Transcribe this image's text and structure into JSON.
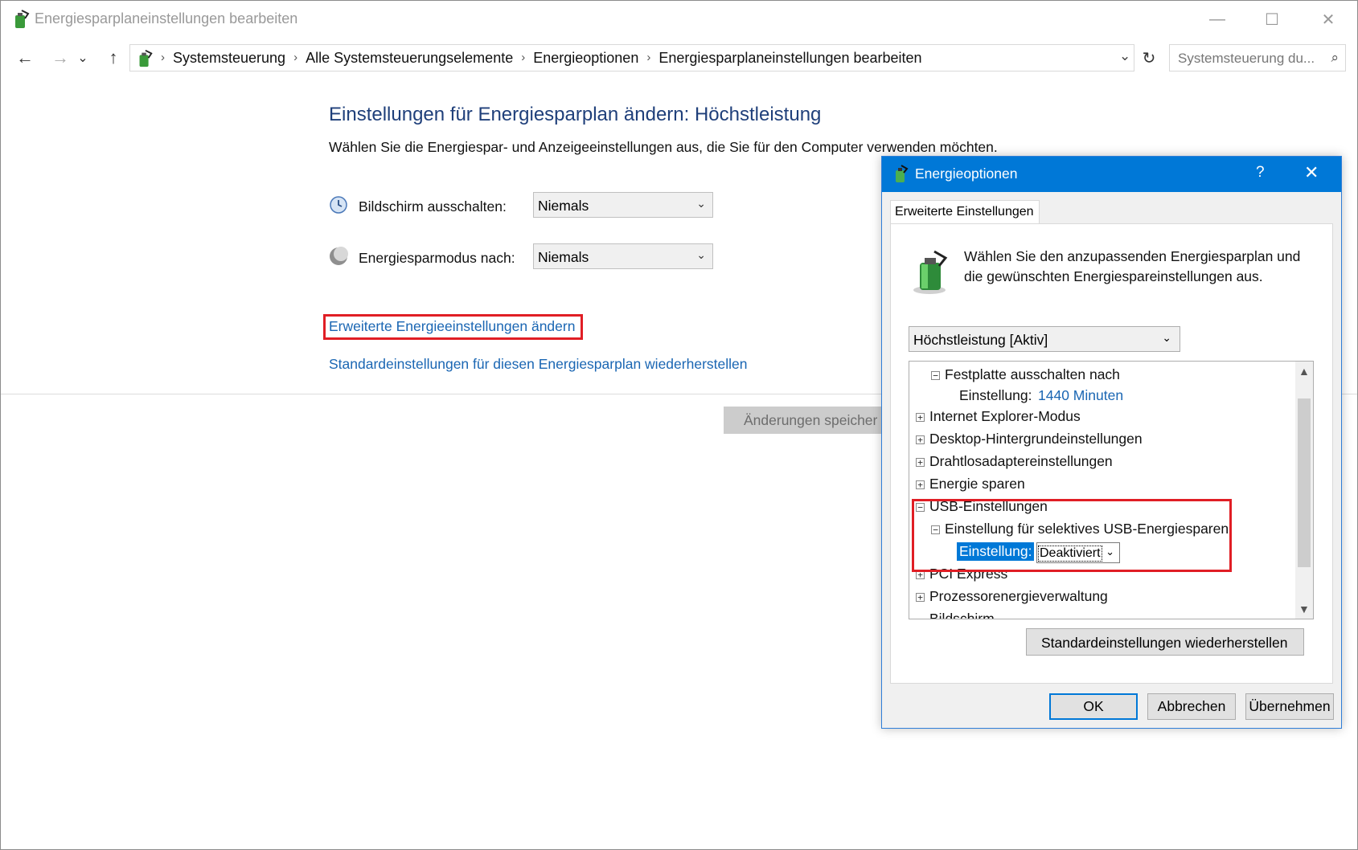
{
  "window": {
    "title": "Energiesparplaneinstellungen bearbeiten",
    "min": "—",
    "max": "☐",
    "close": "✕"
  },
  "nav": {
    "back": "←",
    "forward": "→",
    "recent": "⌄",
    "up": "↑",
    "breadcrumbs": [
      "Systemsteuerung",
      "Alle Systemsteuerungselemente",
      "Energieoptionen",
      "Energiesparplaneinstellungen bearbeiten"
    ],
    "sep": "›",
    "dropdown": "⌄",
    "refresh": "↻",
    "search_placeholder": "Systemsteuerung du...",
    "search_icon": "⌕"
  },
  "main": {
    "title": "Einstellungen für Energiesparplan ändern: Höchstleistung",
    "description": "Wählen Sie die Energiespar- und Anzeigeeinstellungen aus, die Sie für den Computer verwenden möchten.",
    "display_off": {
      "label": "Bildschirm ausschalten:",
      "value": "Niemals"
    },
    "sleep": {
      "label": "Energiesparmodus nach:",
      "value": "Niemals"
    },
    "advanced_link": "Erweiterte Energieeinstellungen ändern",
    "restore_link": "Standardeinstellungen für diesen Energiesparplan wiederherstellen",
    "save_button": "Änderungen speicher"
  },
  "dialog": {
    "title": "Energieoptionen",
    "help": "?",
    "close": "✕",
    "tab": "Erweiterte Einstellungen",
    "description": "Wählen Sie den anzupassenden Energiesparplan und die gewünschten Energiespareinstellungen aus.",
    "plan": "Höchstleistung [Aktiv]",
    "tree": {
      "hdd": "Festplatte ausschalten nach",
      "hdd_setting_label": "Einstellung:",
      "hdd_setting_value": "1440 Minuten",
      "ie": "Internet Explorer-Modus",
      "desktop": "Desktop-Hintergrundeinstellungen",
      "wireless": "Drahtlosadaptereinstellungen",
      "energy": "Energie sparen",
      "usb": "USB-Einstellungen",
      "usb_selective": "Einstellung für selektives USB-Energiesparen",
      "usb_setting_label": "Einstellung:",
      "usb_setting_value": "Deaktiviert",
      "pci": "PCI Express",
      "cpu": "Prozessorenergieverwaltung",
      "cut": "Bildschirm"
    },
    "restore_button": "Standardeinstellungen wiederherstellen",
    "ok": "OK",
    "cancel": "Abbrechen",
    "apply": "Übernehmen"
  },
  "colors": {
    "accent": "#0078d7",
    "link": "#1a66b3",
    "highlight_box": "#e01e25",
    "heading": "#1f3f7a"
  }
}
